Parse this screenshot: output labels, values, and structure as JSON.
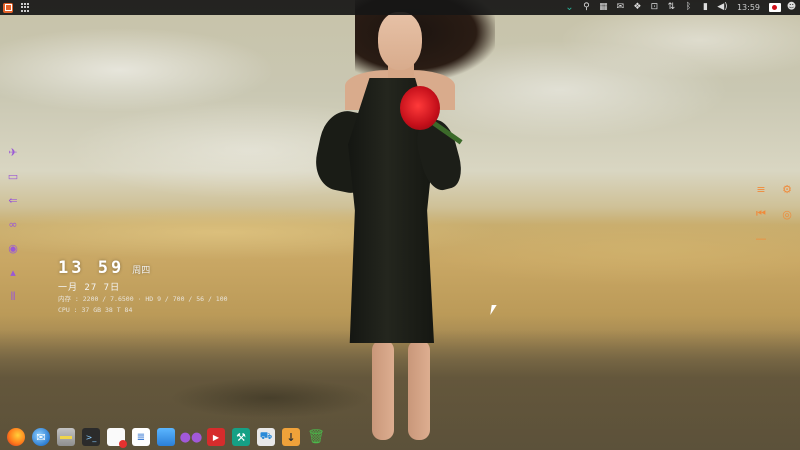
{
  "topbar": {
    "app_menu_icon": "app-menu-icon",
    "launcher_icon": "grid-icon",
    "tray": [
      {
        "name": "chevron-down-icon",
        "glyph": "⌄"
      },
      {
        "name": "search-icon",
        "glyph": "⚲"
      },
      {
        "name": "screen-icon",
        "glyph": "▦"
      },
      {
        "name": "mail-icon",
        "glyph": "✉"
      },
      {
        "name": "dropbox-icon",
        "glyph": "❖"
      },
      {
        "name": "screenshot-icon",
        "glyph": "⊡"
      },
      {
        "name": "network-icon",
        "glyph": "⇅"
      },
      {
        "name": "bluetooth-icon",
        "glyph": "ᛒ"
      },
      {
        "name": "battery-icon",
        "glyph": "▮"
      },
      {
        "name": "volume-icon",
        "glyph": "◀)"
      }
    ],
    "clock": "13:59",
    "user_icon": "user-icon"
  },
  "left_launcher": [
    {
      "name": "plane-icon",
      "glyph": "✈"
    },
    {
      "name": "chat-icon",
      "glyph": "▭"
    },
    {
      "name": "back-arrow-icon",
      "glyph": "⇐"
    },
    {
      "name": "glasses-icon",
      "glyph": "∞"
    },
    {
      "name": "globe-icon",
      "glyph": "◉"
    },
    {
      "name": "lock-icon",
      "glyph": "▴"
    },
    {
      "name": "equalizer-icon",
      "glyph": "⦀"
    }
  ],
  "desktop_clock": {
    "time": "13 59",
    "day": "周四",
    "date": "一月 27 7日",
    "memory": "内存 : 2200 / 7.6500 · HD 9 / 700 / 56 / 100",
    "cpu": "CPU : 37 GB 38 T 84"
  },
  "right_controls": [
    {
      "name": "menu-lines-icon",
      "glyph": "≡"
    },
    {
      "name": "settings-gear-icon",
      "glyph": "⚙"
    },
    {
      "name": "previous-icon",
      "glyph": "⏮"
    },
    {
      "name": "eye-icon",
      "glyph": "◎"
    },
    {
      "name": "minus-icon",
      "glyph": "—"
    }
  ],
  "dock": [
    {
      "name": "firefox-icon",
      "glyph": ""
    },
    {
      "name": "thunderbird-icon",
      "glyph": "✉"
    },
    {
      "name": "file-manager-icon",
      "glyph": ""
    },
    {
      "name": "terminal-icon",
      "glyph": ">_"
    },
    {
      "name": "document-viewer-icon",
      "glyph": ""
    },
    {
      "name": "text-editor-icon",
      "glyph": "≣"
    },
    {
      "name": "system-monitor-icon",
      "glyph": ""
    },
    {
      "name": "chat-app-icon",
      "glyph": "●●"
    },
    {
      "name": "video-player-icon",
      "glyph": "▶"
    },
    {
      "name": "settings-tools-icon",
      "glyph": "⚒"
    },
    {
      "name": "app-store-icon",
      "glyph": "⛟"
    },
    {
      "name": "download-manager-icon",
      "glyph": "↓"
    },
    {
      "name": "trash-icon",
      "glyph": "🗑"
    }
  ],
  "colors": {
    "launcher_accent": "#9a58d6",
    "controls_accent": "#f08a3a",
    "topbar_bg": "#161616",
    "tray_accent": "#27b39a"
  }
}
